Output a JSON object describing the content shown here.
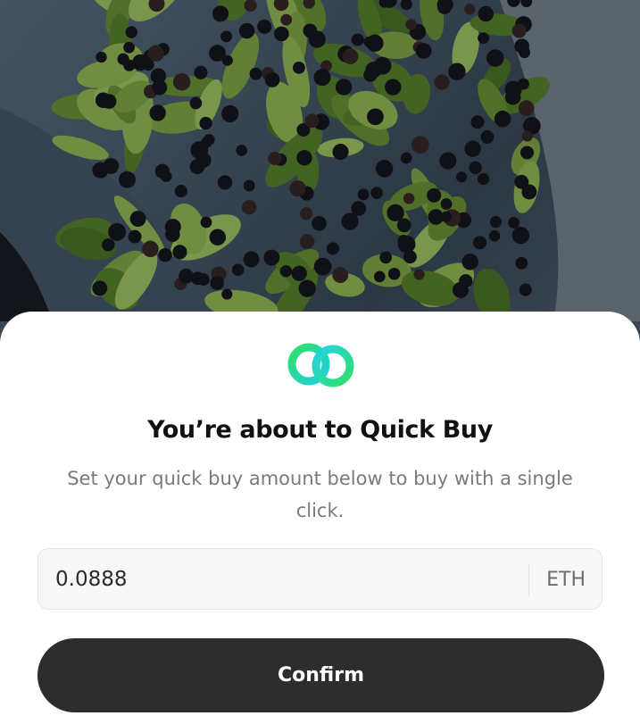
{
  "background": {
    "image": "photo of dark berries and green leaves on a blue-gray cloth"
  },
  "dialog": {
    "logo_icon": "linked-rings-logo",
    "title": "You’re about to Quick Buy",
    "subtitle": "Set your quick buy amount below to buy with a single click.",
    "amount_input": {
      "value": "0.0888",
      "unit": "ETH"
    },
    "confirm_label": "Confirm"
  },
  "colors": {
    "logo_green": "#2bdc6a",
    "logo_cyan": "#23d3e6",
    "button_bg": "#2d2d2d"
  }
}
